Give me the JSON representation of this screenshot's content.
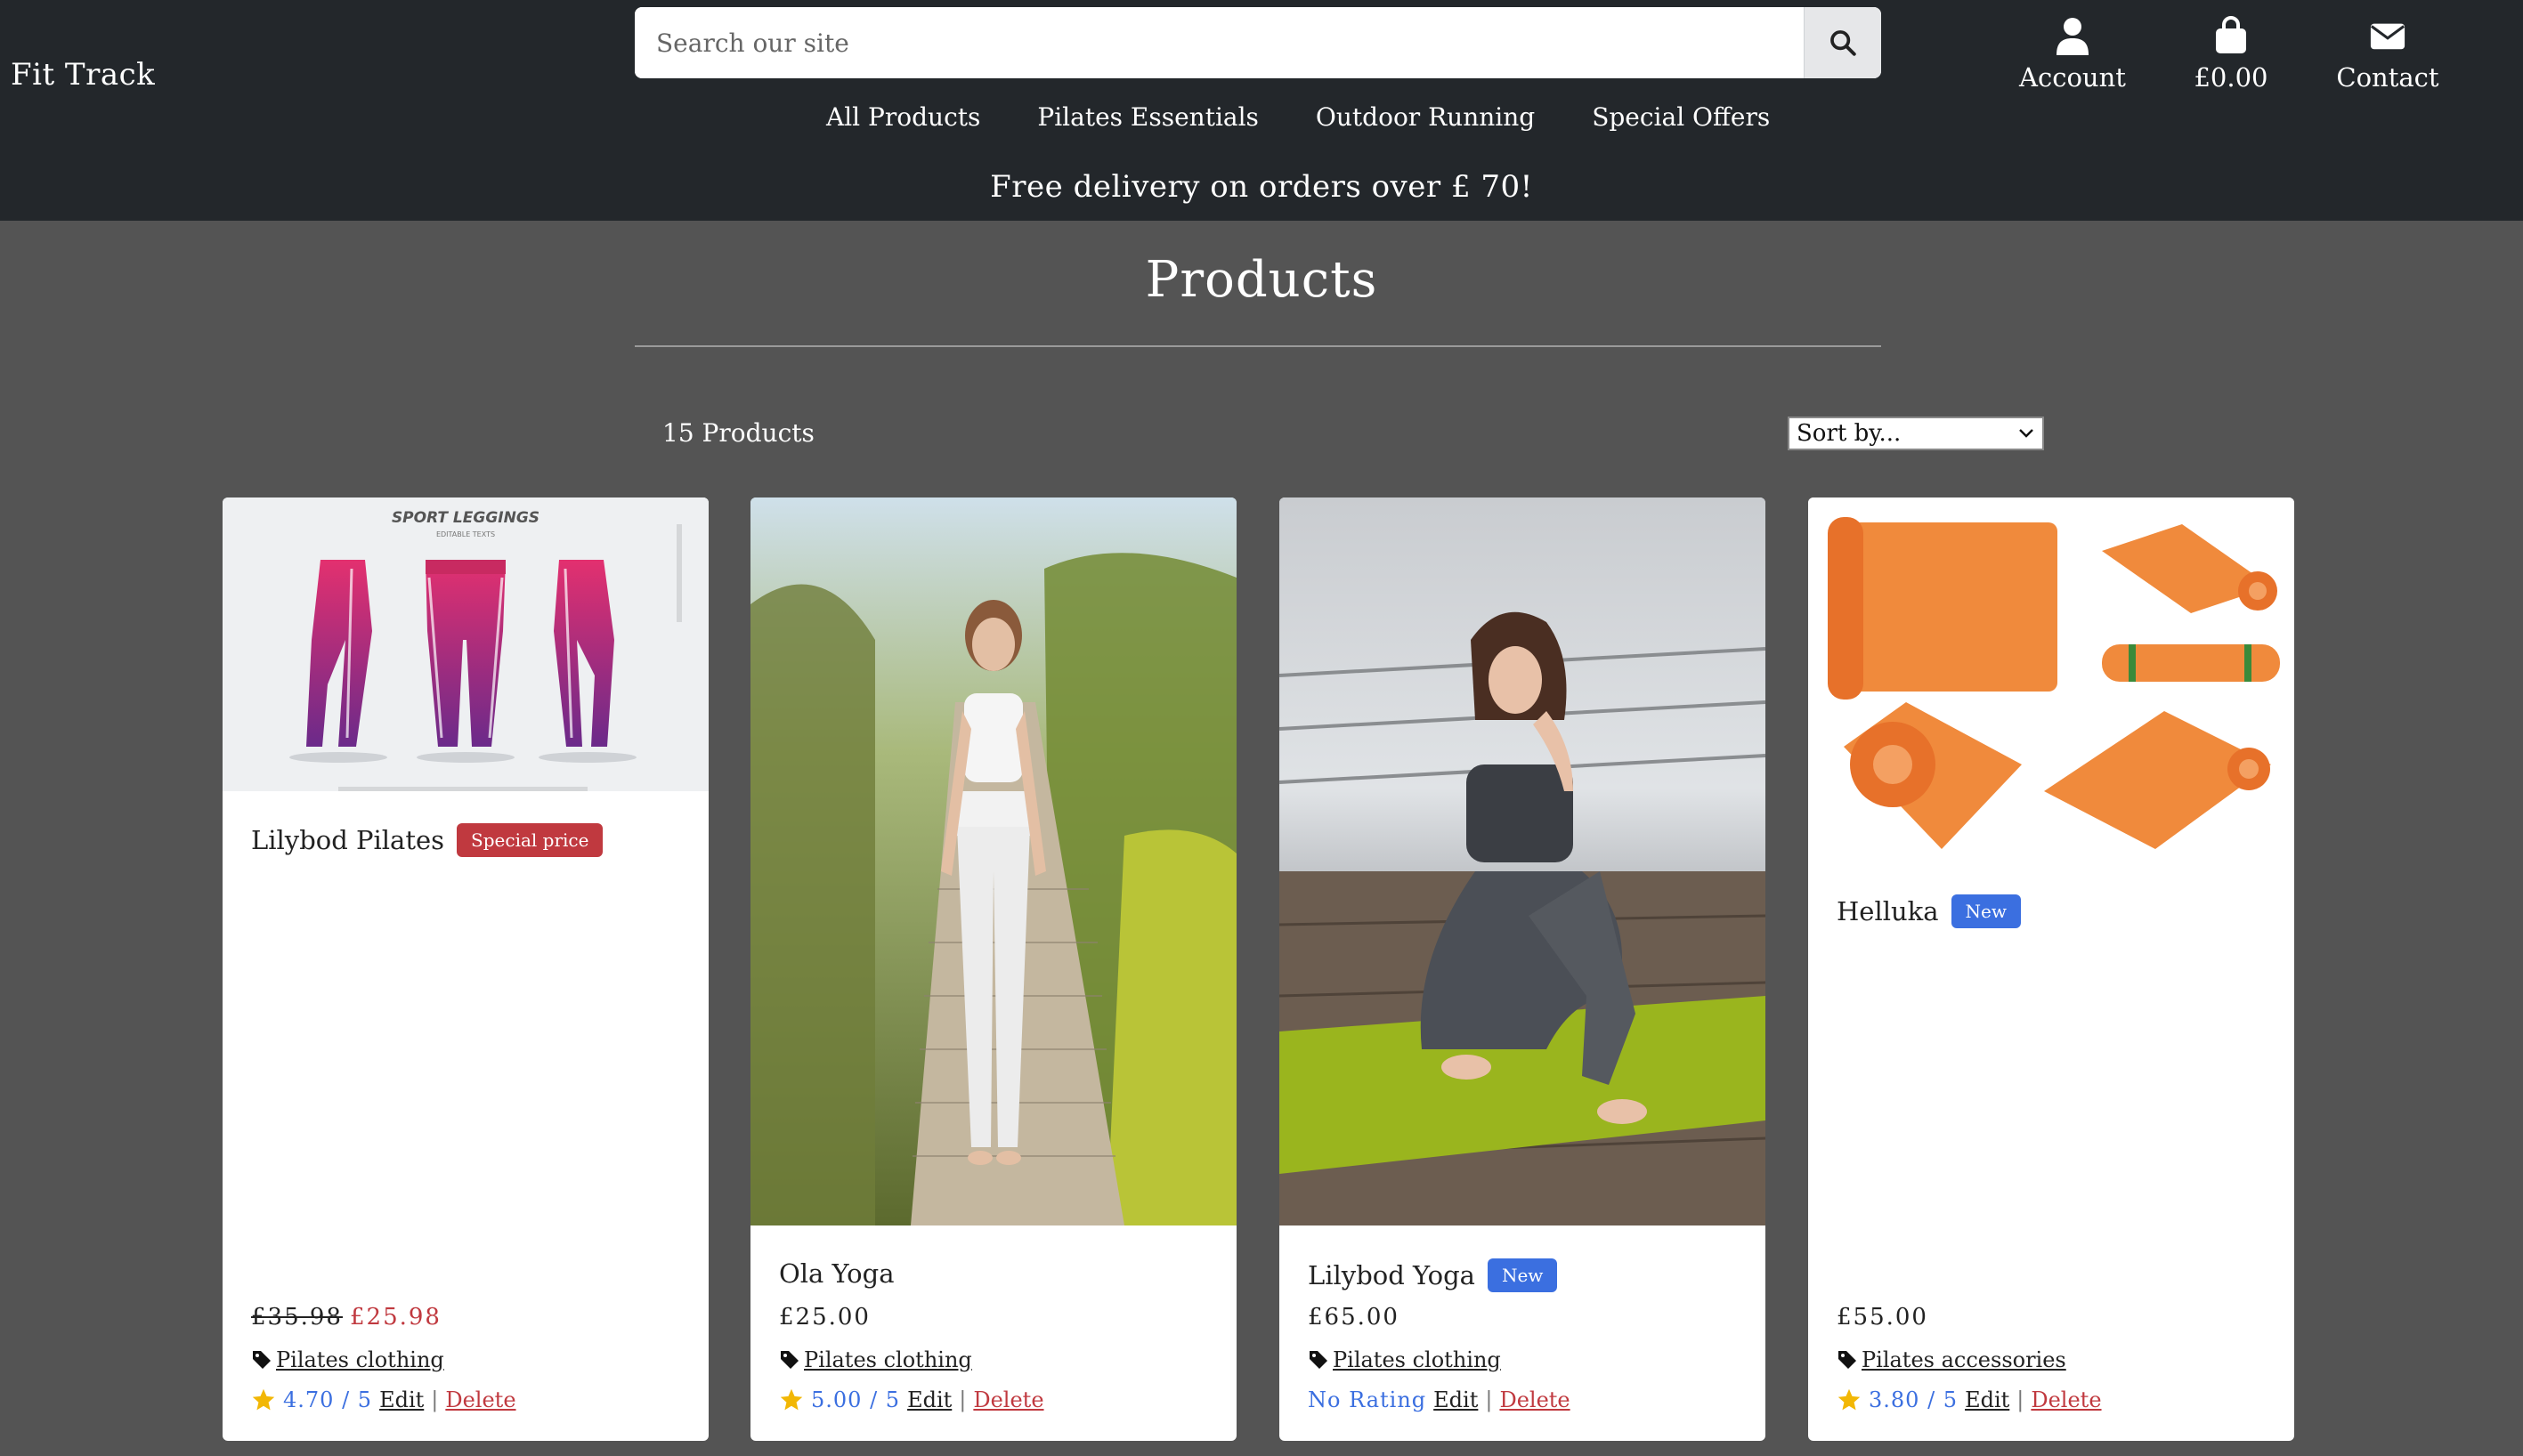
{
  "header": {
    "brand": "Fit Track",
    "search_placeholder": "Search our site",
    "account_label": "Account",
    "cart_label": "£0.00",
    "contact_label": "Contact",
    "menu": [
      "All Products",
      "Pilates Essentials",
      "Outdoor Running",
      "Special Offers"
    ],
    "promo": "Free delivery on orders over £ 70!"
  },
  "main": {
    "title": "Products",
    "count": "15 Products",
    "sort_label": "Sort by..."
  },
  "products": [
    {
      "name": "Lilybod Pilates",
      "badge": "Special price",
      "old_price": "£35.98",
      "price": "£25.98",
      "category": "Pilates clothing",
      "rating": "4.70 / 5",
      "edit": "Edit",
      "delete": "Delete",
      "image_text": "SPORT LEGGINGS",
      "image_subtext": "EDITABLE TEXTS"
    },
    {
      "name": "Ola Yoga",
      "badge": "",
      "price": "£25.00",
      "category": "Pilates clothing",
      "rating": "5.00 / 5",
      "edit": "Edit",
      "delete": "Delete"
    },
    {
      "name": "Lilybod Yoga",
      "badge": "New",
      "price": "£65.00",
      "category": "Pilates clothing",
      "rating": "No Rating",
      "edit": "Edit",
      "delete": "Delete"
    },
    {
      "name": "Helluka",
      "badge": "New",
      "price": "£55.00",
      "category": "Pilates accessories",
      "rating": "3.80 / 5",
      "edit": "Edit",
      "delete": "Delete"
    }
  ],
  "colors": {
    "header_bg": "#23272b",
    "page_bg": "#545454",
    "sale_red": "#c0393f",
    "new_blue": "#3b6fe0",
    "star_yellow": "#f2b705"
  }
}
